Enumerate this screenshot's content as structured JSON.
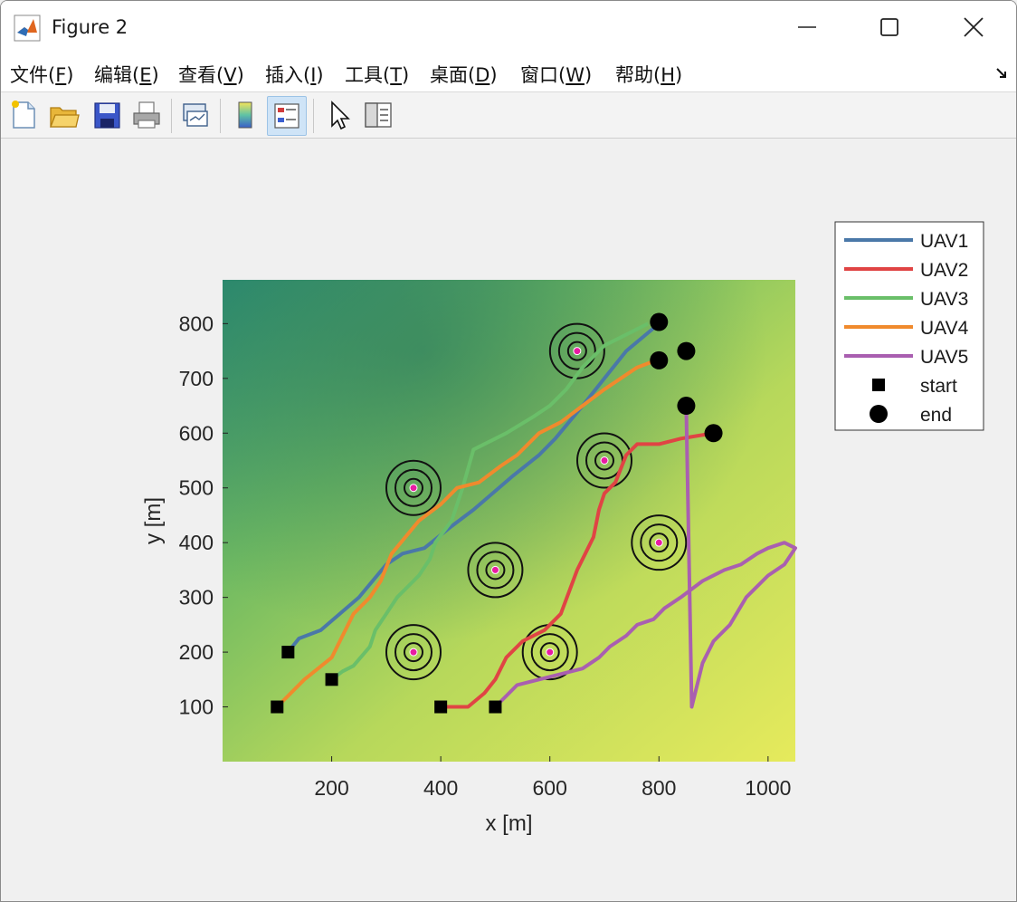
{
  "window": {
    "title": "Figure 2"
  },
  "menu": [
    {
      "label": "文件(",
      "mnemonic": "F",
      "suffix": ")"
    },
    {
      "label": "编辑(",
      "mnemonic": "E",
      "suffix": ")"
    },
    {
      "label": "查看(",
      "mnemonic": "V",
      "suffix": ")"
    },
    {
      "label": "插入(",
      "mnemonic": "I",
      "suffix": ")"
    },
    {
      "label": "工具(",
      "mnemonic": "T",
      "suffix": ")"
    },
    {
      "label": "桌面(",
      "mnemonic": "D",
      "suffix": ")"
    },
    {
      "label": "窗口(",
      "mnemonic": "W",
      "suffix": ")"
    },
    {
      "label": "帮助(",
      "mnemonic": "H",
      "suffix": ")"
    }
  ],
  "toolbar": {
    "icons": [
      "new-figure-icon",
      "open-file-icon",
      "save-icon",
      "print-icon",
      "link-plot-icon",
      "colorbar-icon",
      "legend-icon",
      "pointer-icon",
      "property-inspector-icon"
    ],
    "active": "legend-icon"
  },
  "chart_data": {
    "type": "line",
    "xlabel": "x [m]",
    "ylabel": "y [m]",
    "xlim": [
      0,
      1050
    ],
    "ylim": [
      0,
      880
    ],
    "xticks": [
      200,
      400,
      600,
      800,
      1000
    ],
    "yticks": [
      100,
      200,
      300,
      400,
      500,
      600,
      700,
      800
    ],
    "background": "terrain elevation map (green to yellow)",
    "legend_placement": "outside-top-right",
    "series": [
      {
        "name": "UAV1",
        "color": "#4a78a8",
        "points": [
          [
            120,
            200
          ],
          [
            140,
            225
          ],
          [
            180,
            240
          ],
          [
            250,
            300
          ],
          [
            300,
            360
          ],
          [
            330,
            380
          ],
          [
            370,
            390
          ],
          [
            420,
            430
          ],
          [
            460,
            460
          ],
          [
            530,
            520
          ],
          [
            580,
            560
          ],
          [
            610,
            590
          ],
          [
            660,
            650
          ],
          [
            700,
            700
          ],
          [
            740,
            750
          ],
          [
            800,
            800
          ]
        ]
      },
      {
        "name": "UAV2",
        "color": "#e04444",
        "points": [
          [
            400,
            100
          ],
          [
            450,
            100
          ],
          [
            480,
            125
          ],
          [
            500,
            150
          ],
          [
            520,
            190
          ],
          [
            550,
            220
          ],
          [
            590,
            240
          ],
          [
            620,
            270
          ],
          [
            650,
            350
          ],
          [
            660,
            370
          ],
          [
            670,
            390
          ],
          [
            680,
            410
          ],
          [
            690,
            460
          ],
          [
            700,
            490
          ],
          [
            720,
            510
          ],
          [
            740,
            560
          ],
          [
            760,
            580
          ],
          [
            800,
            580
          ],
          [
            840,
            590
          ],
          [
            900,
            600
          ]
        ]
      },
      {
        "name": "UAV3",
        "color": "#6abf69",
        "points": [
          [
            200,
            150
          ],
          [
            220,
            165
          ],
          [
            240,
            175
          ],
          [
            270,
            210
          ],
          [
            280,
            240
          ],
          [
            300,
            270
          ],
          [
            320,
            300
          ],
          [
            340,
            320
          ],
          [
            360,
            340
          ],
          [
            380,
            370
          ],
          [
            390,
            400
          ],
          [
            420,
            440
          ],
          [
            440,
            500
          ],
          [
            460,
            570
          ],
          [
            520,
            600
          ],
          [
            570,
            630
          ],
          [
            600,
            650
          ],
          [
            630,
            680
          ],
          [
            660,
            720
          ],
          [
            700,
            760
          ],
          [
            780,
            800
          ]
        ]
      },
      {
        "name": "UAV4",
        "color": "#f08a2d",
        "points": [
          [
            100,
            100
          ],
          [
            150,
            150
          ],
          [
            200,
            190
          ],
          [
            220,
            230
          ],
          [
            240,
            270
          ],
          [
            270,
            300
          ],
          [
            290,
            330
          ],
          [
            310,
            380
          ],
          [
            360,
            440
          ],
          [
            400,
            470
          ],
          [
            430,
            500
          ],
          [
            470,
            510
          ],
          [
            510,
            540
          ],
          [
            540,
            560
          ],
          [
            560,
            580
          ],
          [
            580,
            600
          ],
          [
            620,
            620
          ],
          [
            660,
            650
          ],
          [
            700,
            680
          ],
          [
            760,
            720
          ],
          [
            800,
            735
          ]
        ]
      },
      {
        "name": "UAV5",
        "color": "#a95fb0",
        "points": [
          [
            500,
            100
          ],
          [
            520,
            120
          ],
          [
            540,
            140
          ],
          [
            580,
            150
          ],
          [
            620,
            160
          ],
          [
            660,
            170
          ],
          [
            690,
            190
          ],
          [
            710,
            210
          ],
          [
            740,
            230
          ],
          [
            760,
            250
          ],
          [
            790,
            260
          ],
          [
            810,
            280
          ],
          [
            840,
            300
          ],
          [
            880,
            330
          ],
          [
            920,
            350
          ],
          [
            950,
            360
          ],
          [
            980,
            380
          ],
          [
            1000,
            390
          ],
          [
            1030,
            400
          ],
          [
            1050,
            390
          ],
          [
            1030,
            360
          ],
          [
            1000,
            340
          ],
          [
            960,
            300
          ],
          [
            930,
            250
          ],
          [
            900,
            220
          ],
          [
            880,
            180
          ],
          [
            870,
            140
          ],
          [
            860,
            100
          ],
          [
            850,
            650
          ]
        ]
      },
      {
        "name": "start",
        "marker": "square",
        "points": [
          [
            120,
            200
          ],
          [
            400,
            100
          ],
          [
            200,
            150
          ],
          [
            100,
            100
          ],
          [
            500,
            100
          ]
        ]
      },
      {
        "name": "end",
        "marker": "circle",
        "points": [
          [
            800,
            803
          ],
          [
            900,
            600
          ],
          [
            800,
            733
          ],
          [
            850,
            650
          ],
          [
            850,
            750
          ]
        ]
      }
    ],
    "threats": [
      {
        "x": 650,
        "y": 750
      },
      {
        "x": 350,
        "y": 500
      },
      {
        "x": 700,
        "y": 550
      },
      {
        "x": 800,
        "y": 400
      },
      {
        "x": 500,
        "y": 350
      },
      {
        "x": 350,
        "y": 200
      },
      {
        "x": 600,
        "y": 200
      }
    ]
  }
}
